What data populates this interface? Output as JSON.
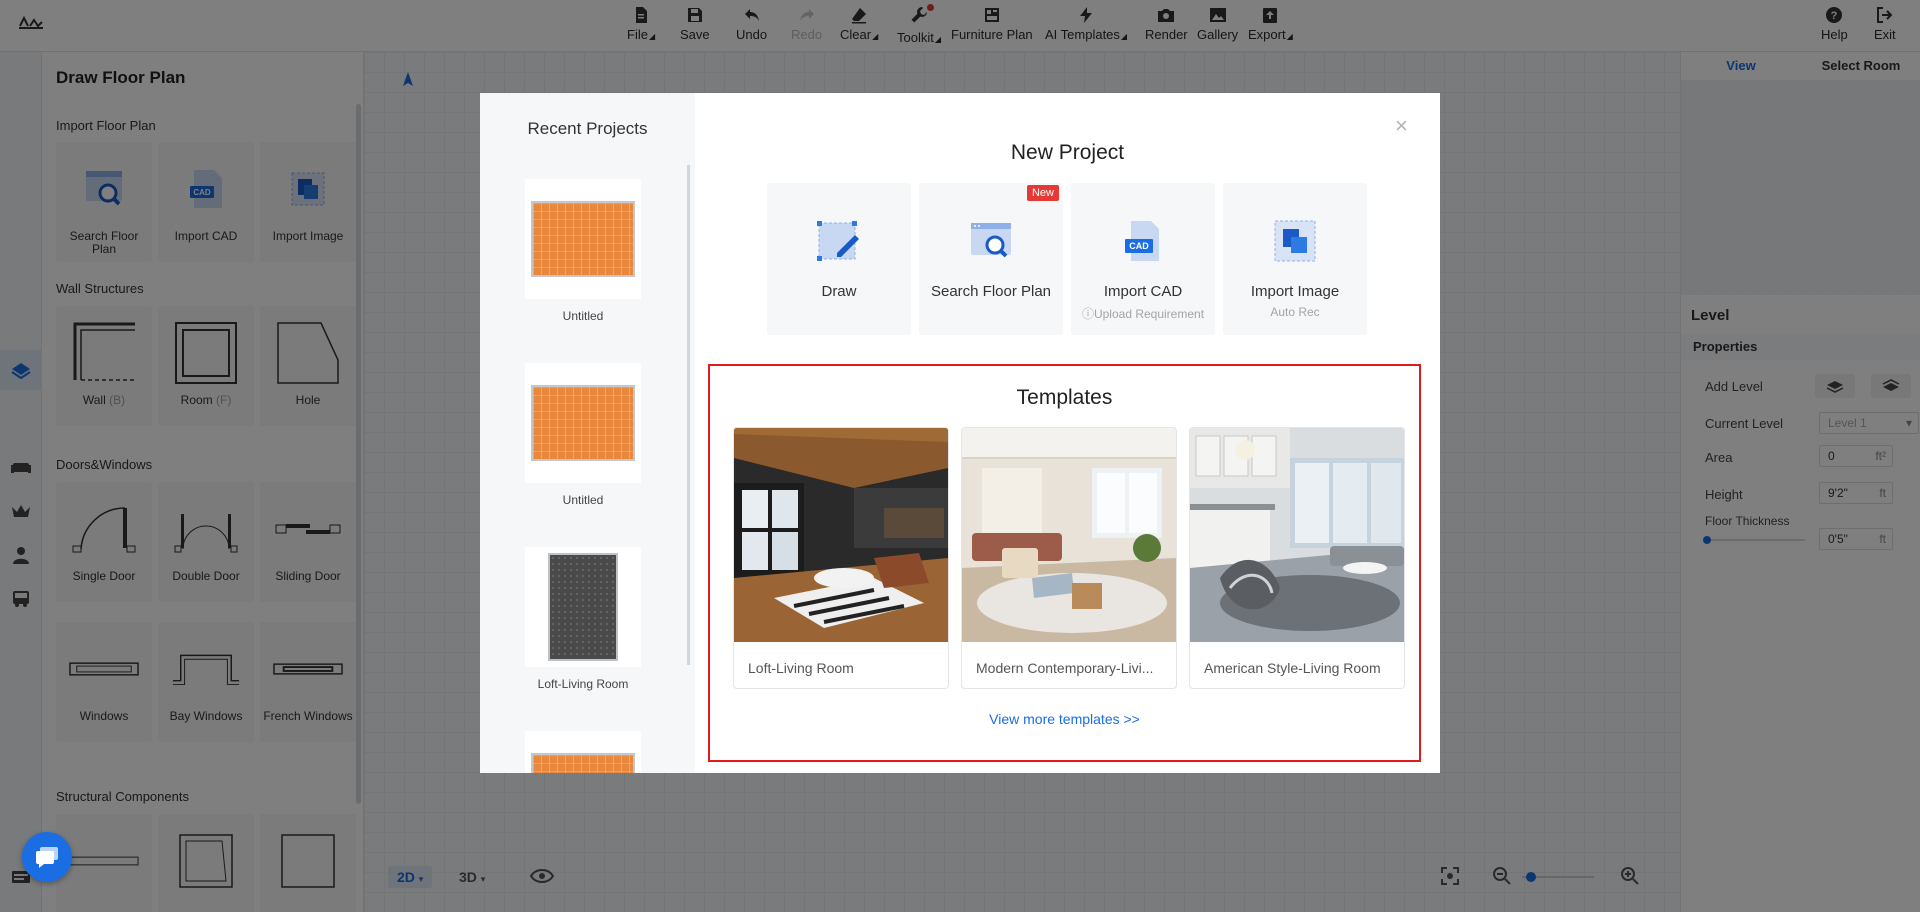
{
  "toolbar": {
    "items": [
      {
        "label": "File",
        "icon": "file-icon",
        "caret": true,
        "enabled": true
      },
      {
        "label": "Save",
        "icon": "save-icon",
        "caret": false,
        "enabled": true
      },
      {
        "label": "Undo",
        "icon": "undo-icon",
        "caret": false,
        "enabled": true
      },
      {
        "label": "Redo",
        "icon": "redo-icon",
        "caret": false,
        "enabled": false
      },
      {
        "label": "Clear",
        "icon": "eraser-icon",
        "caret": true,
        "enabled": true
      },
      {
        "label": "Toolkit",
        "icon": "wrench-icon",
        "caret": true,
        "enabled": true,
        "notification_dot": true
      },
      {
        "label": "Furniture Plan",
        "icon": "furniture-plan-icon",
        "caret": false,
        "enabled": true
      },
      {
        "label": "AI Templates",
        "icon": "lightning-icon",
        "caret": true,
        "enabled": true
      },
      {
        "label": "Render",
        "icon": "camera-icon",
        "caret": false,
        "enabled": true
      },
      {
        "label": "Gallery",
        "icon": "gallery-icon",
        "caret": false,
        "enabled": true
      },
      {
        "label": "Export",
        "icon": "export-icon",
        "caret": true,
        "enabled": true
      }
    ],
    "help_label": "Help",
    "exit_label": "Exit"
  },
  "left_panel": {
    "title": "Draw Floor Plan",
    "sections": [
      {
        "title": "Import Floor Plan",
        "items": [
          {
            "label": "Search Floor Plan",
            "hint": "",
            "icon": "search-floor-plan-icon"
          },
          {
            "label": "Import CAD",
            "hint": "",
            "icon": "cad-file-icon"
          },
          {
            "label": "Import Image",
            "hint": "",
            "icon": "import-image-icon"
          }
        ]
      },
      {
        "title": "Wall Structures",
        "items": [
          {
            "label": "Wall",
            "hint": "(B)",
            "icon": "wall-icon"
          },
          {
            "label": "Room",
            "hint": "(F)",
            "icon": "room-icon"
          },
          {
            "label": "Hole",
            "hint": "",
            "icon": "hole-icon"
          }
        ]
      },
      {
        "title": "Doors&Windows",
        "items": [
          {
            "label": "Single Door",
            "hint": "",
            "icon": "single-door-icon"
          },
          {
            "label": "Double Door",
            "hint": "",
            "icon": "double-door-icon"
          },
          {
            "label": "Sliding Door",
            "hint": "",
            "icon": "sliding-door-icon"
          },
          {
            "label": "Windows",
            "hint": "",
            "icon": "window-icon"
          },
          {
            "label": "Bay Windows",
            "hint": "",
            "icon": "bay-window-icon"
          },
          {
            "label": "French Windows",
            "hint": "",
            "icon": "french-window-icon"
          }
        ]
      },
      {
        "title": "Structural Components",
        "items": []
      }
    ]
  },
  "right_panel": {
    "tabs": [
      {
        "label": "View",
        "active": true
      },
      {
        "label": "Select Room",
        "active": false
      }
    ],
    "level_title": "Level",
    "properties_title": "Properties",
    "add_level_label": "Add Level",
    "current_level_label": "Current Level",
    "current_level_value": "Level 1",
    "area_label": "Area",
    "area_value": "0",
    "area_unit": "ft²",
    "height_label": "Height",
    "height_value": "9'2\"",
    "height_unit": "ft",
    "floor_thickness_label": "Floor Thickness",
    "floor_thickness_value": "0'5\"",
    "floor_thickness_unit": "ft"
  },
  "bottom_bar": {
    "view_2d": "2D",
    "view_3d": "3D"
  },
  "modal": {
    "recent_title": "Recent Projects",
    "recent_projects": [
      {
        "name": "Untitled",
        "style": "orange"
      },
      {
        "name": "Untitled",
        "style": "orange"
      },
      {
        "name": "Loft-Living Room",
        "style": "dark"
      },
      {
        "name": "",
        "style": "orange"
      }
    ],
    "new_project_title": "New Project",
    "new_project_options": [
      {
        "label": "Draw",
        "sub": "",
        "icon": "draw-icon",
        "badge": ""
      },
      {
        "label": "Search Floor Plan",
        "sub": "",
        "icon": "search-floor-plan-icon",
        "badge": "New"
      },
      {
        "label": "Import CAD",
        "sub": "Upload Requirement",
        "icon": "cad-file-icon",
        "badge": ""
      },
      {
        "label": "Import Image",
        "sub": "Auto Rec",
        "icon": "import-image-icon",
        "badge": ""
      }
    ],
    "templates_title": "Templates",
    "templates": [
      {
        "name": "Loft-Living Room"
      },
      {
        "name": "Modern Contemporary-Livi..."
      },
      {
        "name": "American Style-Living Room"
      }
    ],
    "view_more_label": "View more templates >>"
  },
  "colors": {
    "accent": "#1a6de3",
    "highlight_border": "#e21c1c",
    "badge_red": "#e53935"
  }
}
